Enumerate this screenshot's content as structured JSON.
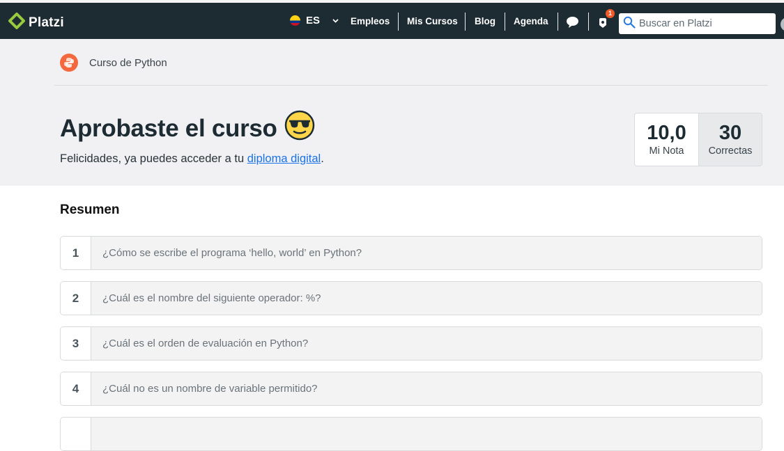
{
  "header": {
    "logo_text": "Platzi",
    "language": "ES",
    "nav": [
      "Empleos",
      "Mis Cursos",
      "Blog",
      "Agenda"
    ],
    "notification_count": "1",
    "search_placeholder": "Buscar en Platzi",
    "icons": [
      "platzi-logo-icon",
      "colombia-flag-icon",
      "chevron-down-icon",
      "chat-bubble-icon",
      "notifications-icon",
      "search-icon"
    ]
  },
  "breadcrumb": {
    "course_name": "Curso de Python",
    "icon": "python-badge-icon"
  },
  "result": {
    "title": "Aprobaste el curso",
    "emoji": "😎",
    "subtitle_prefix": "Felicidades, ya puedes acceder a tu ",
    "diploma_link": "diploma digital",
    "subtitle_suffix": "."
  },
  "score": {
    "grade": "10,0",
    "grade_label": "Mi Nota",
    "correct": "30",
    "correct_label": "Correctas"
  },
  "summary": {
    "title": "Resumen",
    "questions": [
      {
        "num": "1",
        "text": "¿Cómo se escribe el programa ‘hello, world’ en Python?"
      },
      {
        "num": "2",
        "text": "¿Cuál es el nombre del siguiente operador: %?"
      },
      {
        "num": "3",
        "text": "¿Cuál es el orden de evaluación en Python?"
      },
      {
        "num": "4",
        "text": "¿Cuál no es un nombre de variable permitido?"
      },
      {
        "num": "",
        "text": ""
      }
    ]
  },
  "colors": {
    "topbar": "#1d2b33",
    "accent_green": "#98ca3f",
    "link": "#1a73e8",
    "badge": "#f05a28"
  }
}
